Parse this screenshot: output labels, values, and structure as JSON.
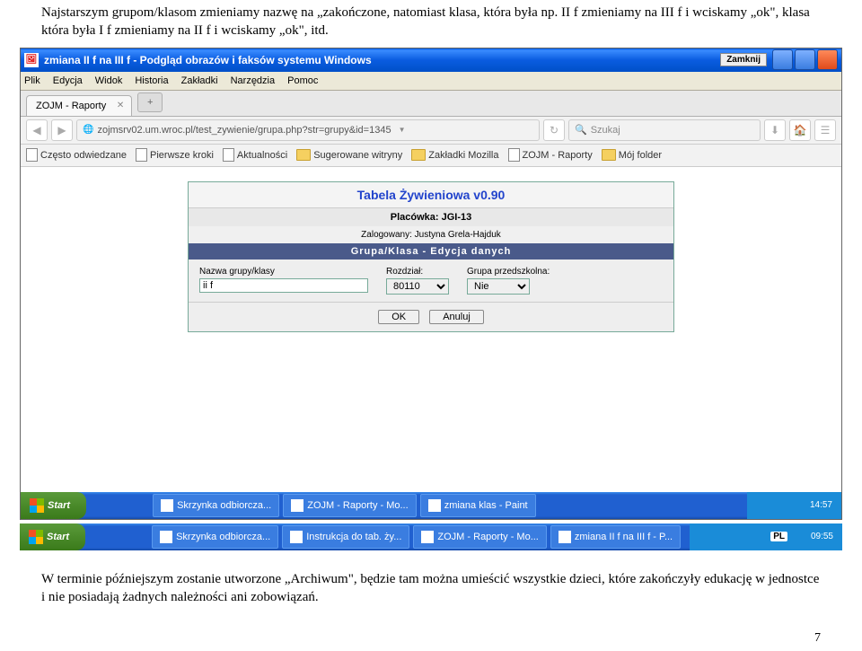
{
  "doc": {
    "top_text": "Najstarszym grupom/klasom zmieniamy nazwę na „zakończone, natomiast klasa, która była np. II f  zmieniamy na III f  i wciskamy „ok\", klasa która była I f zmieniamy na II f  i wciskamy „ok\", itd.",
    "bottom_text": "W terminie późniejszym zostanie utworzone „Archiwum\", będzie tam można umieścić wszystkie dzieci, które zakończyły edukację w jednostce i nie posiadają żadnych należności ani zobowiązań.",
    "page_number": "7"
  },
  "window": {
    "title": "zmiana II f na III f - Podgląd obrazów i faksów systemu Windows",
    "close_label": "Zamknij"
  },
  "menu": {
    "items": [
      "Plik",
      "Edycja",
      "Widok",
      "Historia",
      "Zakładki",
      "Narzędzia",
      "Pomoc"
    ]
  },
  "tab": {
    "label": "ZOJM - Raporty"
  },
  "url": "zojmsrv02.um.wroc.pl/test_zywienie/grupa.php?str=grupy&id=1345",
  "search_placeholder": "Szukaj",
  "bookmarks": [
    "Często odwiedzane",
    "Pierwsze kroki",
    "Aktualności",
    "Sugerowane witryny",
    "Zakładki Mozilla",
    "ZOJM - Raporty",
    "Mój folder"
  ],
  "app": {
    "title": "Tabela Żywieniowa v0.90",
    "placowka_label": "Placówka: JGI-13",
    "logged_in": "Zalogowany: Justyna Grela-Hajduk",
    "section": "Grupa/Klasa - Edycja danych",
    "field_nazwa": "Nazwa grupy/klasy",
    "field_nazwa_value": "ii f",
    "field_rozdzial": "Rozdział:",
    "field_rozdzial_value": "80110",
    "field_grupa": "Grupa przedszkolna:",
    "field_grupa_value": "Nie",
    "btn_ok": "OK",
    "btn_anuluj": "Anuluj"
  },
  "taskbar_inner": {
    "start": "Start",
    "items": [
      "Skrzynka odbiorcza...",
      "ZOJM - Raporty - Mo...",
      "zmiana klas - Paint"
    ],
    "time": "14:57"
  },
  "taskbar_outer": {
    "start": "Start",
    "items": [
      "Skrzynka odbiorcza...",
      "Instrukcja do tab. ży...",
      "ZOJM - Raporty - Mo...",
      "zmiana II f na III f - P..."
    ],
    "time": "09:55"
  }
}
